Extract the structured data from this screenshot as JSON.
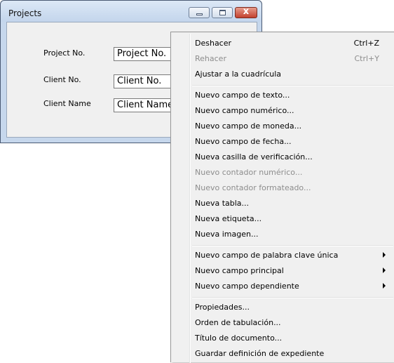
{
  "window": {
    "title": "Projects",
    "close_glyph": "x"
  },
  "form": {
    "project_no_label": "Project No.",
    "project_no_value": "Project No.",
    "client_no_label": "Client No.",
    "client_no_value": "Client No.",
    "client_name_label": "Client Name",
    "client_name_value": "Client Name"
  },
  "menu": {
    "undo": {
      "label": "Deshacer",
      "shortcut": "Ctrl+Z"
    },
    "redo": {
      "label": "Rehacer",
      "shortcut": "Ctrl+Y",
      "disabled": true
    },
    "snap_grid": {
      "label": "Ajustar a la cuadrícula"
    },
    "new_text_field": {
      "label": "Nuevo campo de texto..."
    },
    "new_numeric_field": {
      "label": "Nuevo campo numérico..."
    },
    "new_currency_field": {
      "label": "Nuevo campo de moneda..."
    },
    "new_date_field": {
      "label": "Nuevo campo de fecha..."
    },
    "new_checkbox": {
      "label": "Nueva casilla de verificación..."
    },
    "new_numeric_counter": {
      "label": "Nuevo contador numérico...",
      "disabled": true
    },
    "new_formatted_counter": {
      "label": "Nuevo contador formateado...",
      "disabled": true
    },
    "new_table": {
      "label": "Nueva tabla..."
    },
    "new_label": {
      "label": "Nueva etiqueta..."
    },
    "new_image": {
      "label": "Nueva imagen..."
    },
    "new_unique_keyword_field": {
      "label": "Nuevo campo de palabra clave única",
      "submenu": true
    },
    "new_primary_field": {
      "label": "Nuevo campo principal",
      "submenu": true
    },
    "new_dependent_field": {
      "label": "Nuevo campo dependiente",
      "submenu": true
    },
    "properties": {
      "label": "Propiedades..."
    },
    "tab_order": {
      "label": "Orden de tabulación..."
    },
    "document_title": {
      "label": "Título de documento..."
    },
    "save_case_definition": {
      "label": "Guardar definición de expediente"
    }
  },
  "colors": {
    "window_frame": "#c6d7ec",
    "close_button": "#c2412e",
    "menu_background": "#f0f0f0",
    "disabled_text": "#8d8d8d"
  }
}
